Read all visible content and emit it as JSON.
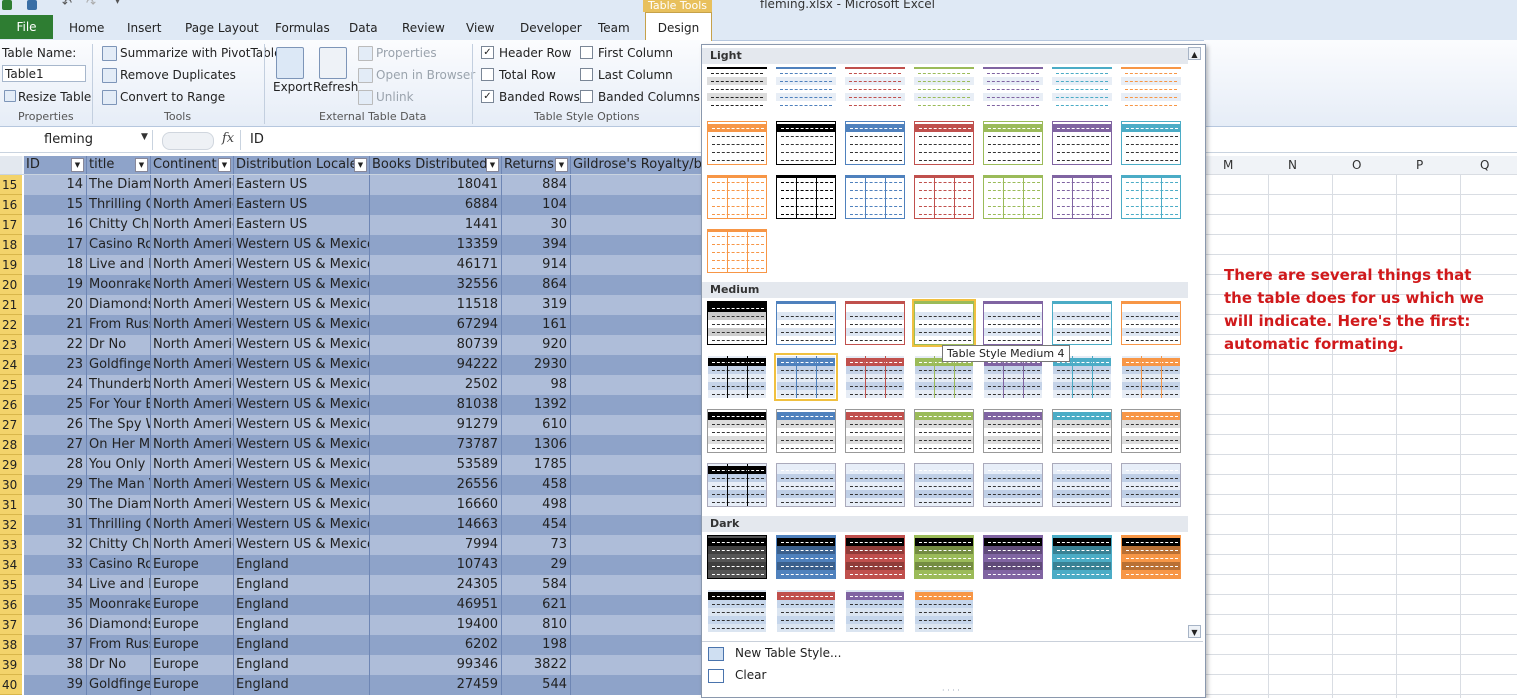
{
  "window": {
    "title": "fleming.xlsx - Microsoft Excel",
    "context_tab": "Table Tools"
  },
  "tabs": [
    "Home",
    "Insert",
    "Page Layout",
    "Formulas",
    "Data",
    "Review",
    "View",
    "Developer",
    "Team"
  ],
  "file_tab": "File",
  "design_tab": "Design",
  "ribbon": {
    "properties": {
      "table_name_label": "Table Name:",
      "table_name_value": "Table1",
      "resize": "Resize Table",
      "group": "Properties"
    },
    "tools": {
      "summarize": "Summarize with PivotTable",
      "remove_dupes": "Remove Duplicates",
      "convert": "Convert to Range",
      "group": "Tools"
    },
    "external": {
      "export": "Export",
      "refresh": "Refresh",
      "properties": "Properties",
      "open_browser": "Open in Browser",
      "unlink": "Unlink",
      "group": "External Table Data"
    },
    "options": {
      "header_row": "Header Row",
      "total_row": "Total Row",
      "banded_rows": "Banded Rows",
      "first_column": "First Column",
      "last_column": "Last Column",
      "banded_columns": "Banded Columns",
      "header_row_checked": true,
      "total_row_checked": false,
      "banded_rows_checked": true,
      "first_column_checked": false,
      "last_column_checked": false,
      "banded_columns_checked": false,
      "group": "Table Style Options"
    }
  },
  "formula_bar": {
    "name_box": "fleming",
    "fx": "fx",
    "value": "ID"
  },
  "columns": {
    "headers": [
      "ID",
      "title",
      "Continent",
      "Distribution Locale",
      "Books Distributed",
      "Returns",
      "Gildrose's Royalty/bo"
    ],
    "right_letters": [
      "M",
      "N",
      "O",
      "P",
      "Q"
    ]
  },
  "rows": [
    {
      "r": "15",
      "id": "14",
      "title": "The Diamo",
      "cont": "North Americ",
      "loc": "Eastern US",
      "books": "18041",
      "ret": "884"
    },
    {
      "r": "16",
      "id": "15",
      "title": "Thrilling C",
      "cont": "North Americ",
      "loc": "Eastern US",
      "books": "6884",
      "ret": "104"
    },
    {
      "r": "17",
      "id": "16",
      "title": "Chitty Chi",
      "cont": "North Americ",
      "loc": "Eastern US",
      "books": "1441",
      "ret": "30"
    },
    {
      "r": "18",
      "id": "17",
      "title": "Casino Ro",
      "cont": "North Americ",
      "loc": "Western US & Mexico",
      "books": "13359",
      "ret": "394"
    },
    {
      "r": "19",
      "id": "18",
      "title": "Live and L",
      "cont": "North Americ",
      "loc": "Western US & Mexico",
      "books": "46171",
      "ret": "914"
    },
    {
      "r": "20",
      "id": "19",
      "title": "Moonrake",
      "cont": "North Americ",
      "loc": "Western US & Mexico",
      "books": "32556",
      "ret": "864"
    },
    {
      "r": "21",
      "id": "20",
      "title": "Diamonds",
      "cont": "North Americ",
      "loc": "Western US & Mexico",
      "books": "11518",
      "ret": "319"
    },
    {
      "r": "22",
      "id": "21",
      "title": "From Russ",
      "cont": "North Americ",
      "loc": "Western US & Mexico",
      "books": "67294",
      "ret": "161"
    },
    {
      "r": "23",
      "id": "22",
      "title": "Dr No",
      "cont": "North Americ",
      "loc": "Western US & Mexico",
      "books": "80739",
      "ret": "920"
    },
    {
      "r": "24",
      "id": "23",
      "title": "Goldfinge",
      "cont": "North Americ",
      "loc": "Western US & Mexico",
      "books": "94222",
      "ret": "2930"
    },
    {
      "r": "25",
      "id": "24",
      "title": "Thunderb",
      "cont": "North Americ",
      "loc": "Western US & Mexico",
      "books": "2502",
      "ret": "98"
    },
    {
      "r": "26",
      "id": "25",
      "title": "For Your E",
      "cont": "North Americ",
      "loc": "Western US & Mexico",
      "books": "81038",
      "ret": "1392"
    },
    {
      "r": "27",
      "id": "26",
      "title": "The Spy W",
      "cont": "North Americ",
      "loc": "Western US & Mexico",
      "books": "91279",
      "ret": "610"
    },
    {
      "r": "28",
      "id": "27",
      "title": "On Her Ma",
      "cont": "North Americ",
      "loc": "Western US & Mexico",
      "books": "73787",
      "ret": "1306"
    },
    {
      "r": "29",
      "id": "28",
      "title": "You Only I",
      "cont": "North Americ",
      "loc": "Western US & Mexico",
      "books": "53589",
      "ret": "1785"
    },
    {
      "r": "30",
      "id": "29",
      "title": "The Man V",
      "cont": "North Americ",
      "loc": "Western US & Mexico",
      "books": "26556",
      "ret": "458"
    },
    {
      "r": "31",
      "id": "30",
      "title": "The Diamo",
      "cont": "North Americ",
      "loc": "Western US & Mexico",
      "books": "16660",
      "ret": "498"
    },
    {
      "r": "32",
      "id": "31",
      "title": "Thrilling C",
      "cont": "North Americ",
      "loc": "Western US & Mexico",
      "books": "14663",
      "ret": "454"
    },
    {
      "r": "33",
      "id": "32",
      "title": "Chitty Chi",
      "cont": "North Americ",
      "loc": "Western US & Mexico",
      "books": "7994",
      "ret": "73"
    },
    {
      "r": "34",
      "id": "33",
      "title": "Casino Ro",
      "cont": "Europe",
      "loc": "England",
      "books": "10743",
      "ret": "29"
    },
    {
      "r": "35",
      "id": "34",
      "title": "Live and L",
      "cont": "Europe",
      "loc": "England",
      "books": "24305",
      "ret": "584"
    },
    {
      "r": "36",
      "id": "35",
      "title": "Moonrake",
      "cont": "Europe",
      "loc": "England",
      "books": "46951",
      "ret": "621"
    },
    {
      "r": "37",
      "id": "36",
      "title": "Diamonds",
      "cont": "Europe",
      "loc": "England",
      "books": "19400",
      "ret": "810"
    },
    {
      "r": "38",
      "id": "37",
      "title": "From Russ",
      "cont": "Europe",
      "loc": "England",
      "books": "6202",
      "ret": "198"
    },
    {
      "r": "39",
      "id": "38",
      "title": "Dr No",
      "cont": "Europe",
      "loc": "England",
      "books": "99346",
      "ret": "3822"
    },
    {
      "r": "40",
      "id": "39",
      "title": "Goldfinge",
      "cont": "Europe",
      "loc": "England",
      "books": "27459",
      "ret": "544"
    }
  ],
  "gallery": {
    "sections": {
      "light": "Light",
      "medium": "Medium",
      "dark": "Dark"
    },
    "tooltip": "Table Style Medium 4",
    "new_style": "New Table Style...",
    "clear": "Clear",
    "colors": {
      "none": "#404040",
      "black": "#000000",
      "blue": "#4f81bd",
      "red": "#c0504d",
      "green": "#9bbb59",
      "purple": "#8064a2",
      "aqua": "#4bacc6",
      "orange": "#f79646",
      "selected": "#f0c040"
    }
  },
  "note": "There are several things that the table does for us which we will indicate. Here's the first: automatic formating."
}
